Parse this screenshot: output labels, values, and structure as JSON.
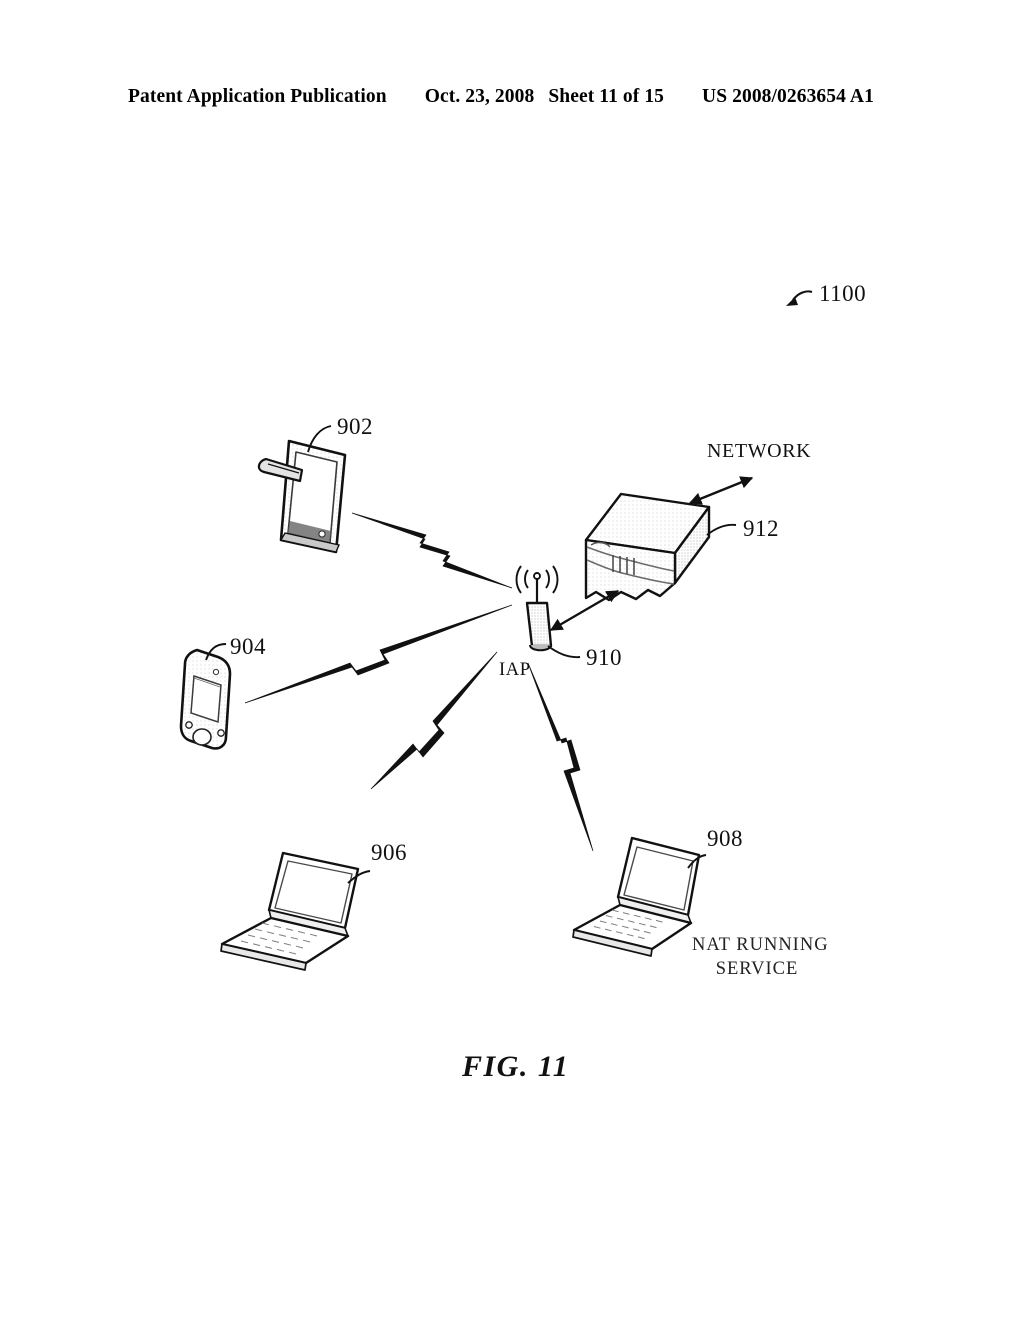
{
  "header": {
    "title": "Patent Application Publication",
    "date": "Oct. 23, 2008",
    "sheet": "Sheet 11 of 15",
    "publication_number": "US 2008/0263654 A1"
  },
  "figure": {
    "caption": "FIG. 11",
    "diagram_number": "1100",
    "labels": {
      "network": "NETWORK",
      "iap": "IAP",
      "nat_service_line1": "NAT RUNNING",
      "nat_service_line2": "SERVICE"
    },
    "reference_numerals": {
      "tablet": "902",
      "pda": "904",
      "laptop_left": "906",
      "laptop_right": "908",
      "access_point": "910",
      "router": "912"
    },
    "nodes": [
      {
        "id": "902",
        "type": "tablet-device",
        "label": "902"
      },
      {
        "id": "904",
        "type": "handheld-pda",
        "label": "904"
      },
      {
        "id": "906",
        "type": "laptop",
        "label": "906"
      },
      {
        "id": "908",
        "type": "laptop",
        "label": "908",
        "annotation": "NAT RUNNING SERVICE"
      },
      {
        "id": "910",
        "type": "wireless-access-point",
        "label": "910",
        "annotation": "IAP"
      },
      {
        "id": "912",
        "type": "router-gateway",
        "label": "912"
      }
    ],
    "connections": [
      {
        "from": "902",
        "to": "910",
        "style": "wireless-lightning"
      },
      {
        "from": "904",
        "to": "910",
        "style": "wireless-lightning"
      },
      {
        "from": "906",
        "to": "910",
        "style": "wireless-lightning"
      },
      {
        "from": "910",
        "to": "908",
        "style": "wireless-lightning"
      },
      {
        "from": "910",
        "to": "912",
        "style": "double-arrow"
      },
      {
        "from": "912",
        "to": "NETWORK",
        "style": "double-arrow"
      }
    ]
  },
  "colors": {
    "ink": "#111111",
    "paper": "#ffffff",
    "shade": "#d8d8d8"
  }
}
